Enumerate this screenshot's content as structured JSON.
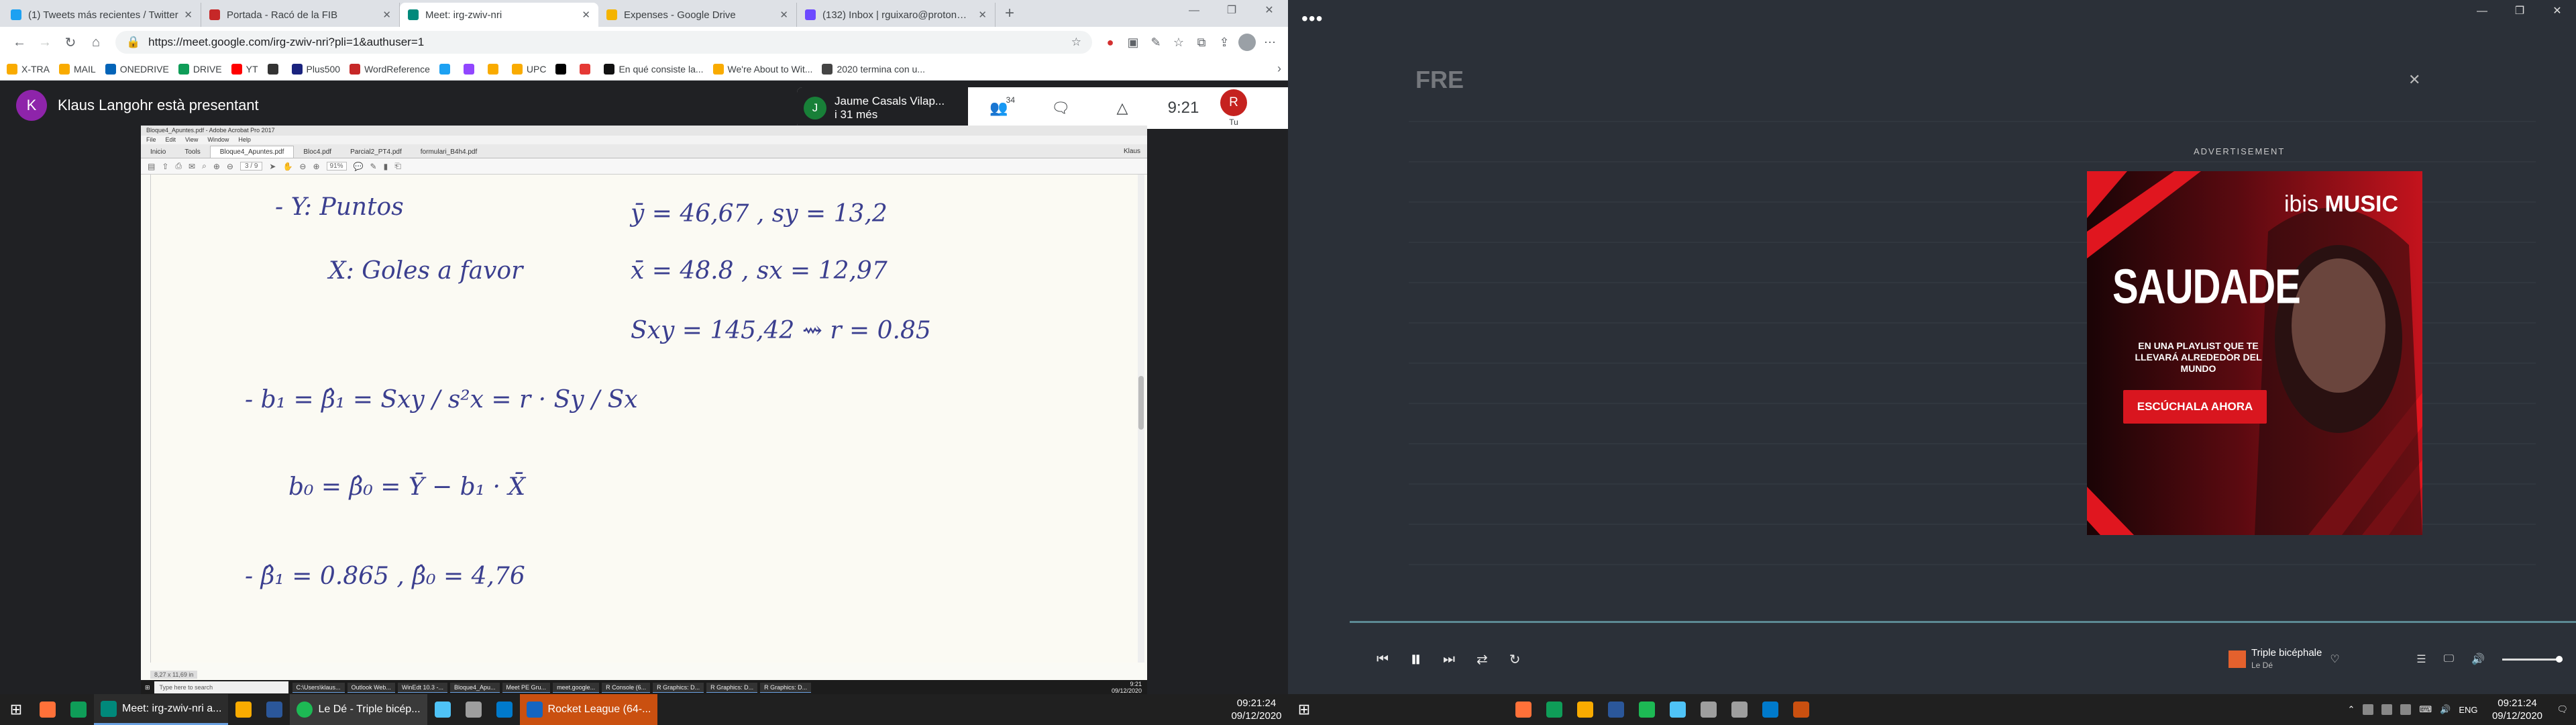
{
  "browser": {
    "tabs": [
      {
        "label": "(1) Tweets más recientes / Twitter",
        "color": "#1da1f2",
        "active": false
      },
      {
        "label": "Portada - Racó de la FIB",
        "color": "#c62828",
        "active": false
      },
      {
        "label": "Meet: irg-zwiv-nri",
        "color": "#00897b",
        "active": true
      },
      {
        "label": "Expenses - Google Drive",
        "color": "#f4b400",
        "active": false
      },
      {
        "label": "(132) Inbox | rguixaro@protonmail",
        "color": "#6d4aff",
        "active": false
      }
    ],
    "new_tab": "+",
    "url": "https://meet.google.com/irg-zwiv-nri?pli=1&authuser=1",
    "bookmarks": [
      {
        "label": "X-TRA",
        "color": "#f9ab00"
      },
      {
        "label": "MAIL",
        "color": "#f9ab00"
      },
      {
        "label": "ONEDRIVE",
        "color": "#0364b8"
      },
      {
        "label": "DRIVE",
        "color": "#0f9d58"
      },
      {
        "label": "YT",
        "color": "#ff0000"
      },
      {
        "label": "",
        "color": "#333333"
      },
      {
        "label": "Plus500",
        "color": "#1a237e"
      },
      {
        "label": "WordReference",
        "color": "#c62828"
      },
      {
        "label": "",
        "color": "#1da1f2"
      },
      {
        "label": "",
        "color": "#9146ff"
      },
      {
        "label": "",
        "color": "#f9ab00"
      },
      {
        "label": "UPC",
        "color": "#f9ab00"
      },
      {
        "label": "",
        "color": "#000000"
      },
      {
        "label": "",
        "color": "#e53935"
      },
      {
        "label": "En qué consiste la...",
        "color": "#111111"
      },
      {
        "label": "We're About to Wit...",
        "color": "#f9ab00"
      },
      {
        "label": "2020 termina con u...",
        "color": "#444444"
      }
    ]
  },
  "meet": {
    "presenter_initial": "K",
    "presenter_text": "Klaus Langohr està presentant",
    "participant_initial": "J",
    "participant_name": "Jaume Casals Vilap...",
    "participant_time": "i 31 més",
    "people_count": "34",
    "time": "9:21",
    "user_initial": "R",
    "user_label": "Tu"
  },
  "shared_screen": {
    "title": "Bloque4_Apuntes.pdf - Adobe Acrobat Pro 2017",
    "menu": [
      "File",
      "Edit",
      "View",
      "Window",
      "Help"
    ],
    "tabs": [
      "Inicio",
      "Tools",
      "Bloque4_Apuntes.pdf",
      "Bloc4.pdf",
      "Parcial2_PT4.pdf",
      "formulari_B4h4.pdf"
    ],
    "user": "Klaus",
    "page": "3 / 9",
    "zoom": "91%",
    "lines": [
      "-   Y:  Puntos",
      "ȳ = 46,67 ,   sy = 13,2",
      "X:  Goles a favor",
      "x̄ = 48.8 ,   sx = 12,97",
      "Sxy = 145,42   ⇝  r = 0.85",
      "-  b₁ = β̂₁ = Sxy / s²x = r · Sy / Sx",
      "b₀ = β̂₀ = Ȳ − b₁ · X̄",
      "-  β̂₁ = 0.865  ,  β̂₀ = 4,76"
    ],
    "doc_size": "8,27 x 11,69 in",
    "inner_search": "Type here to search",
    "inner_tasks": [
      "C:\\Users\\klaus...",
      "Outlook Web...",
      "WinEdt 10.3 -...",
      "Bloque4_Apu...",
      "Meet PE Gru...",
      "meet.google...",
      "R Console (6...",
      "R Graphics: D...",
      "R Graphics: D...",
      "R Graphics: D..."
    ],
    "inner_clock_time": "9:21",
    "inner_clock_date": "09/12/2020"
  },
  "taskbar_left": {
    "apps": [
      {
        "label": "Meet: irg-zwiv-nri a...",
        "color": "#00897b",
        "style": "open"
      },
      {
        "label": "Le Dé - Triple bicép...",
        "color": "#1db954",
        "style": "active"
      },
      {
        "label": "Rocket League (64-...",
        "color": "#1565c0",
        "style": "alert"
      }
    ],
    "pinned_a": [
      "#ff7139",
      "#0f9d58"
    ],
    "pinned_b": [
      "#f9ab00",
      "#2b579a"
    ],
    "pinned_c": [
      "#4fc3f7",
      "#9e9e9e",
      "#007acc"
    ],
    "time": "09:21:24",
    "date": "09/12/2020"
  },
  "spotify_bg": {
    "title": "FRE"
  },
  "ad": {
    "label": "ADVERTISEMENT",
    "brand_left": "ibis",
    "brand_right": "MUSIC",
    "headline": "SAUDADE",
    "subline": "EN UNA PLAYLIST QUE TE LLEVARÁ ALREDEDOR DEL MUNDO",
    "cta": "ESCÚCHALA AHORA",
    "close": "✕"
  },
  "player": {
    "song": "Triple bicéphale",
    "artist": "Le Dé"
  },
  "taskbar_right": {
    "lang": "ENG",
    "time": "09:21:24",
    "date": "09/12/2020",
    "icons": [
      "#ff7139",
      "#0f9d58",
      "#f9ab00",
      "#2b579a",
      "#1db954",
      "#4fc3f7",
      "#9e9e9e",
      "#9e9e9e",
      "#007acc",
      "#ca5010"
    ]
  }
}
